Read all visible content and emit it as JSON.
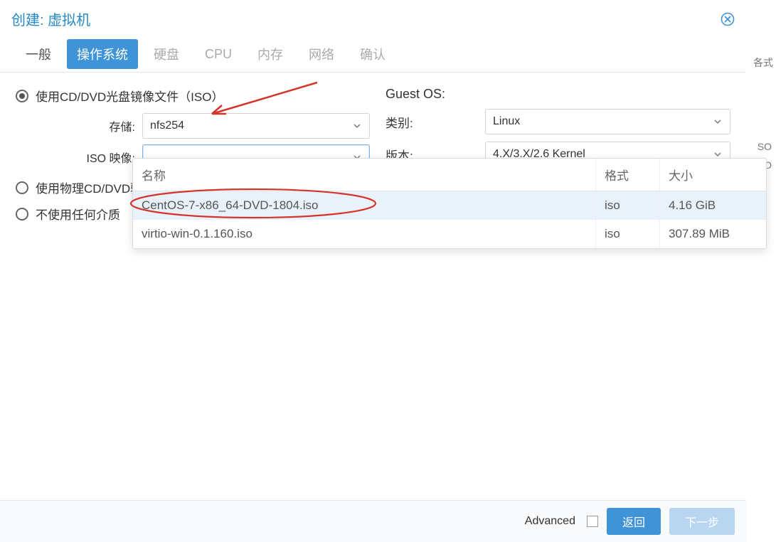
{
  "dialog": {
    "title": "创建: 虚拟机",
    "tabs": [
      {
        "label": "一般"
      },
      {
        "label": "操作系统"
      },
      {
        "label": "硬盘"
      },
      {
        "label": "CPU"
      },
      {
        "label": "内存"
      },
      {
        "label": "网络"
      },
      {
        "label": "确认"
      }
    ]
  },
  "radios": {
    "use_iso": "使用CD/DVD光盘镜像文件（ISO）",
    "use_physical": "使用物理CD/DVD驱动器",
    "use_none": "不使用任何介质"
  },
  "form": {
    "storage_label": "存储:",
    "storage_value": "nfs254",
    "iso_label": "ISO 映像:",
    "iso_value": ""
  },
  "guest": {
    "heading": "Guest OS:",
    "category_label": "类别:",
    "category_value": "Linux",
    "version_label": "版本:",
    "version_value": "4.X/3.X/2.6 Kernel"
  },
  "dropdown": {
    "cols": {
      "name": "名称",
      "format": "格式",
      "size": "大小"
    },
    "rows": [
      {
        "name": "CentOS-7-x86_64-DVD-1804.iso",
        "format": "iso",
        "size": "4.16 GiB"
      },
      {
        "name": "virtio-win-0.1.160.iso",
        "format": "iso",
        "size": "307.89 MiB"
      }
    ]
  },
  "footer": {
    "advanced": "Advanced",
    "back": "返回",
    "next": "下一步"
  },
  "bg": {
    "frag1": "各式",
    "frag2": "SO",
    "frag3": "SO"
  }
}
